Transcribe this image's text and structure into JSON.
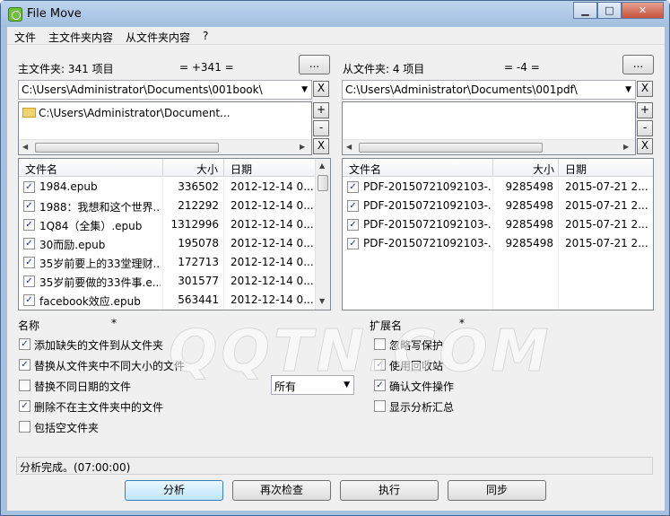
{
  "window": {
    "title": "File Move"
  },
  "menu": [
    "文件",
    "主文件夹内容",
    "从文件夹内容",
    "?"
  ],
  "left": {
    "header_label": "主文件夹: 341 项目",
    "diff": "= +341 =",
    "path": "C:\\Users\\Administrator\\Documents\\001book\\",
    "folder_entry": "C:\\Users\\Administrator\\Document...",
    "columns": [
      "文件名",
      "大小",
      "日期"
    ],
    "rows": [
      {
        "name": "1984.epub",
        "size": "336502",
        "date": "2012-12-14 0..."
      },
      {
        "name": "1988：我想和这个世界...",
        "size": "212292",
        "date": "2012-12-14 0..."
      },
      {
        "name": "1Q84（全集）.epub",
        "size": "1312996",
        "date": "2012-12-14 0..."
      },
      {
        "name": "30而励.epub",
        "size": "195078",
        "date": "2012-12-14 0..."
      },
      {
        "name": "35岁前要上的33堂理财...",
        "size": "172713",
        "date": "2012-12-14 0..."
      },
      {
        "name": "35岁前要做的33件事.e...",
        "size": "301577",
        "date": "2012-12-14 0..."
      },
      {
        "name": "facebook效应.epub",
        "size": "563441",
        "date": "2012-12-14 0..."
      }
    ]
  },
  "right": {
    "header_label": "从文件夹: 4 项目",
    "diff": "= -4 =",
    "path": "C:\\Users\\Administrator\\Documents\\001pdf\\",
    "columns": [
      "文件名",
      "大小",
      "日期"
    ],
    "rows": [
      {
        "name": "PDF-20150721092103-...",
        "size": "9285498",
        "date": "2015-07-21 2..."
      },
      {
        "name": "PDF-20150721092103-...",
        "size": "9285498",
        "date": "2015-07-21 2..."
      },
      {
        "name": "PDF-20150721092103-...",
        "size": "9285498",
        "date": "2015-07-21 2..."
      },
      {
        "name": "PDF-20150721092103-...",
        "size": "9285498",
        "date": "2015-07-21 2..."
      }
    ]
  },
  "buttons": {
    "browse": "...",
    "clear": "X",
    "add": "+",
    "remove": "-"
  },
  "filters": {
    "name_label": "名称",
    "name_value": "*",
    "ext_label": "扩展名",
    "ext_value": "*"
  },
  "options_left": [
    {
      "label": "添加缺失的文件到从文件夹",
      "checked": true
    },
    {
      "label": "替换从文件夹中不同大小的文件",
      "checked": true
    },
    {
      "label": "替换不同日期的文件",
      "checked": false
    },
    {
      "label": "删除不在主文件夹中的文件",
      "checked": true
    },
    {
      "label": "包括空文件夹",
      "checked": false
    }
  ],
  "options_right": [
    {
      "label": "忽略写保护",
      "checked": false
    },
    {
      "label": "使用回收站",
      "checked": true
    },
    {
      "label": "确认文件操作",
      "checked": true
    },
    {
      "label": "显示分析汇总",
      "checked": false
    }
  ],
  "date_mode": "所有",
  "status": "分析完成。(07:00:00)",
  "actions": {
    "analyze": "分析",
    "recheck": "再次检查",
    "execute": "执行",
    "sync": "同步"
  },
  "watermark": "QQTN.COM"
}
